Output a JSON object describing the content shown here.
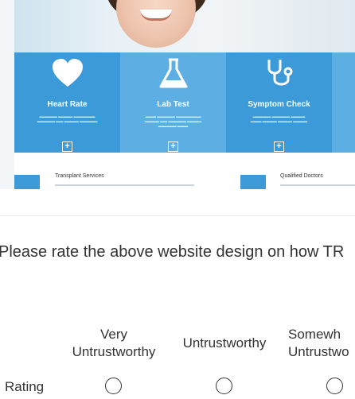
{
  "website_preview": {
    "panels": [
      {
        "title": "Heart Rate",
        "icon": "heart-icon"
      },
      {
        "title": "Lab Test",
        "icon": "flask-icon"
      },
      {
        "title": "Symptom Check",
        "icon": "stethoscope-icon"
      }
    ],
    "services": [
      "Transplant Services",
      "Qualified Doctors"
    ]
  },
  "survey": {
    "question": "Please rate the above website design on how TR",
    "columns": [
      "Very\nUntrustworthy",
      "Untrustworthy",
      "Somewh\nUntrustwo"
    ],
    "row_label": "Rating",
    "selected": null
  },
  "colors": {
    "panel_dark": "#3d9ad8",
    "panel_light": "#5caee3",
    "text": "#333333"
  }
}
